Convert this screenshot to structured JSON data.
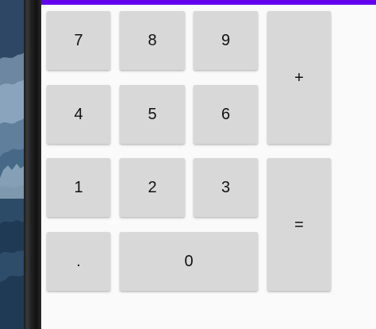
{
  "app": {
    "accent_color": "#6200ee",
    "screen_background": "#fafafa",
    "key_background": "#d8d8d8",
    "key_text_color": "#111111"
  },
  "keypad": {
    "keys": {
      "seven": "7",
      "eight": "8",
      "nine": "9",
      "plus": "+",
      "four": "4",
      "five": "5",
      "six": "6",
      "one": "1",
      "two": "2",
      "three": "3",
      "equals": "=",
      "decimal": ".",
      "zero": "0"
    }
  }
}
